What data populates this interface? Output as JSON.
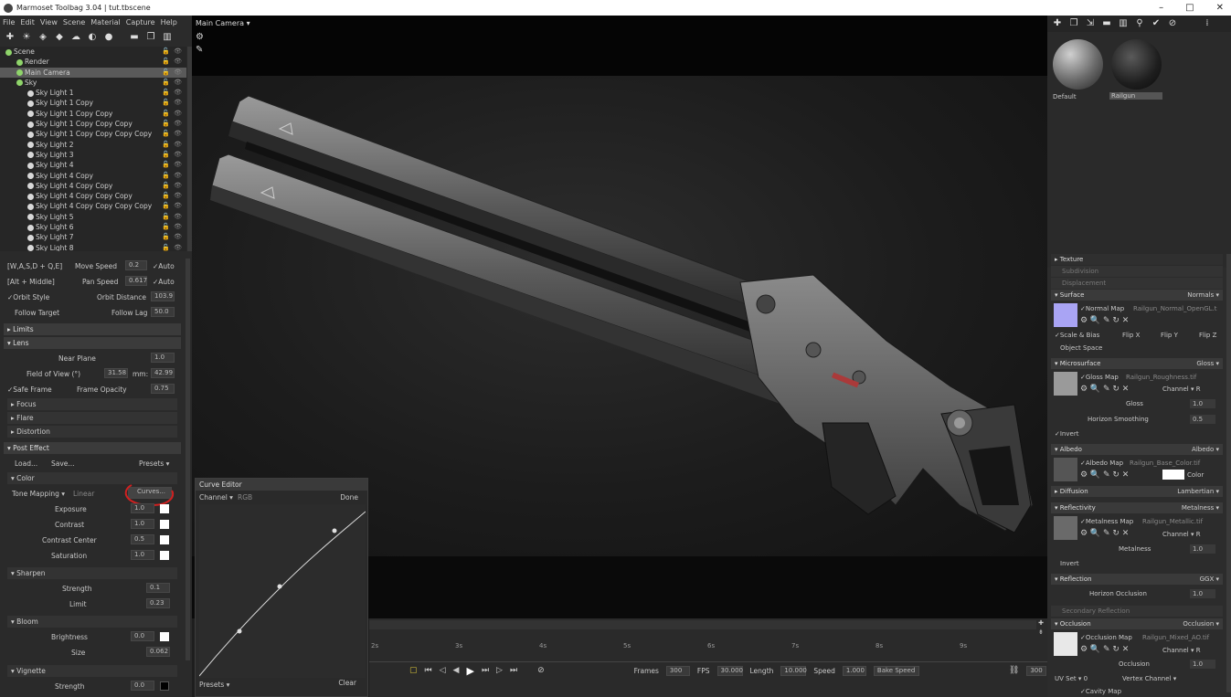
{
  "window": {
    "title": "Marmoset Toolbag 3.04  |  tut.tbscene",
    "min": "–",
    "max": "□",
    "close": "✕"
  },
  "menu": [
    "File",
    "Edit",
    "View",
    "Scene",
    "Material",
    "Capture",
    "Help"
  ],
  "outliner": {
    "items": [
      {
        "label": "Scene",
        "indent": 0,
        "selected": false
      },
      {
        "label": "Render",
        "indent": 1,
        "selected": false
      },
      {
        "label": "Main Camera",
        "indent": 1,
        "selected": true
      },
      {
        "label": "Sky",
        "indent": 1,
        "selected": false
      },
      {
        "label": "Sky Light 1",
        "indent": 2,
        "selected": false
      },
      {
        "label": "Sky Light 1 Copy",
        "indent": 2,
        "selected": false
      },
      {
        "label": "Sky Light 1 Copy Copy",
        "indent": 2,
        "selected": false
      },
      {
        "label": "Sky Light 1 Copy Copy Copy",
        "indent": 2,
        "selected": false
      },
      {
        "label": "Sky Light 1 Copy Copy Copy Copy",
        "indent": 2,
        "selected": false
      },
      {
        "label": "Sky Light 2",
        "indent": 2,
        "selected": false
      },
      {
        "label": "Sky Light 3",
        "indent": 2,
        "selected": false
      },
      {
        "label": "Sky Light 4",
        "indent": 2,
        "selected": false
      },
      {
        "label": "Sky Light 4 Copy",
        "indent": 2,
        "selected": false
      },
      {
        "label": "Sky Light 4 Copy Copy",
        "indent": 2,
        "selected": false
      },
      {
        "label": "Sky Light 4 Copy Copy Copy",
        "indent": 2,
        "selected": false
      },
      {
        "label": "Sky Light 4 Copy Copy Copy Copy",
        "indent": 2,
        "selected": false
      },
      {
        "label": "Sky Light 5",
        "indent": 2,
        "selected": false
      },
      {
        "label": "Sky Light 6",
        "indent": 2,
        "selected": false
      },
      {
        "label": "Sky Light 7",
        "indent": 2,
        "selected": false
      },
      {
        "label": "Sky Light 8",
        "indent": 2,
        "selected": false
      }
    ]
  },
  "camera": {
    "wasd": "[W,A,S,D + Q,E]",
    "move_speed_label": "Move Speed",
    "move_speed": "0.2",
    "auto1": "✓Auto",
    "alt_middle": "[Alt + Middle]",
    "pan_speed_label": "Pan Speed",
    "pan_speed": "0.617",
    "auto2": "✓Auto",
    "orbit_style": "✓Orbit Style",
    "orbit_distance_label": "Orbit Distance",
    "orbit_distance": "103.9",
    "follow_target": "Follow Target",
    "follow_lag_label": "Follow Lag",
    "follow_lag": "50.0",
    "limits": "▸ Limits",
    "lens": "▾ Lens",
    "near_plane_label": "Near Plane",
    "near_plane": "1.0",
    "fov_label": "Field of View (°)",
    "fov": "31.58",
    "mm_label": "mm:",
    "mm": "42.99",
    "safe_frame": "✓Safe Frame",
    "frame_opacity_label": "Frame Opacity",
    "frame_opacity": "0.75",
    "focus": "▸ Focus",
    "flare": "▸ Flare",
    "distortion": "▸ Distortion",
    "post_effect": "▾ Post Effect",
    "load": "Load...",
    "save": "Save...",
    "presets": "Presets ▾",
    "color": "▾ Color",
    "tone_mapping_label": "Tone Mapping ▾",
    "tone_mapping": "Linear",
    "curves": "Curves...",
    "exposure_label": "Exposure",
    "exposure": "1.0",
    "contrast_label": "Contrast",
    "contrast": "1.0",
    "contrast_center_label": "Contrast Center",
    "contrast_center": "0.5",
    "saturation_label": "Saturation",
    "saturation": "1.0",
    "sharpen": "▾ Sharpen",
    "strength_label": "Strength",
    "strength": "0.1",
    "limit_label": "Limit",
    "limit": "0.23",
    "bloom": "▾ Bloom",
    "brightness_label": "Brightness",
    "brightness": "0.0",
    "size_label": "Size",
    "size": "0.062",
    "vignette": "▾ Vignette",
    "v_strength_label": "Strength",
    "v_strength": "0.0"
  },
  "viewport": {
    "camera_menu": "Main Camera ▾"
  },
  "curve_editor": {
    "title": "Curve Editor",
    "channel_label": "Channel ▾",
    "channel": "RGB",
    "done": "Done",
    "presets": "Presets ▾",
    "clear": "Clear"
  },
  "timeline": {
    "ticks": [
      "2s",
      "3s",
      "4s",
      "5s",
      "6s",
      "7s",
      "8s",
      "9s"
    ],
    "frames_label": "Frames",
    "frames": "300",
    "fps_label": "FPS",
    "fps": "30.000",
    "length_label": "Length",
    "length": "10.000",
    "speed_label": "Speed",
    "speed": "1.000",
    "bake_speed": "Bake Speed",
    "end_frame": "300"
  },
  "materials": {
    "default": "Default",
    "railgun": "Railgun"
  },
  "inspector": {
    "texture": "▸ Texture",
    "subdivision": "Subdivision",
    "displacement": "Displacement",
    "surface": "▾ Surface",
    "surface_val": "Normals ▾",
    "normal_map_label": "✓Normal Map",
    "normal_map": "Railgun_Normal_OpenGL.t",
    "scale_bias": "✓Scale & Bias",
    "flip_x": "Flip X",
    "flip_y": "Flip Y",
    "flip_z": "Flip Z",
    "object_space": "Object Space",
    "microsurface": "▾ Microsurface",
    "microsurface_val": "Gloss ▾",
    "gloss_map_label": "✓Gloss Map",
    "gloss_map": "Railgun_Roughness.tif",
    "channel_r": "Channel ▾ R",
    "gloss_label": "Gloss",
    "gloss": "1.0",
    "horizon_smoothing_label": "Horizon Smoothing",
    "horizon_smoothing": "0.5",
    "invert": "✓Invert",
    "albedo": "▾ Albedo",
    "albedo_val": "Albedo ▾",
    "albedo_map_label": "✓Albedo Map",
    "albedo_map": "Railgun_Base_Color.tif",
    "color_label": "Color",
    "diffusion": "▸ Diffusion",
    "diffusion_val": "Lambertian ▾",
    "reflectivity": "▾ Reflectivity",
    "reflectivity_val": "Metalness ▾",
    "metalness_map_label": "✓Metalness Map",
    "metalness_map": "Railgun_Metallic.tif",
    "metalness_label": "Metalness",
    "metalness": "1.0",
    "invert2": "Invert",
    "reflection": "▾ Reflection",
    "reflection_val": "GGX ▾",
    "horizon_occlusion_label": "Horizon Occlusion",
    "horizon_occlusion": "1.0",
    "secondary_reflection": "Secondary Reflection",
    "occlusion": "▾ Occlusion",
    "occlusion_val": "Occlusion ▾",
    "occlusion_map_label": "✓Occlusion Map",
    "occlusion_map": "Railgun_Mixed_AO.tif",
    "occlusion_label": "Occlusion",
    "occlusion_value": "1.0",
    "uv_set": "UV Set ▾ 0",
    "vertex_channel": "Vertex Channel ▾",
    "cavity_map": "✓Cavity Map"
  }
}
